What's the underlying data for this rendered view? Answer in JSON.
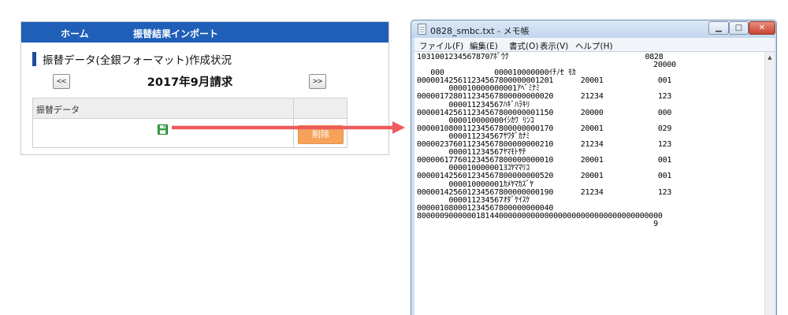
{
  "web": {
    "nav": {
      "home": "ホーム",
      "import": "振替結果インポート"
    },
    "section_title": "振替データ(全銀フォーマット)作成状況",
    "month": {
      "prev": "<<",
      "label": "2017年9月請求",
      "next": ">>"
    },
    "table": {
      "header": "振替データ"
    },
    "delete_label": "削除",
    "colors": {
      "navbar": "#1f5fb8",
      "delete": "#f6a25b",
      "arrow": "#ef5b5b"
    }
  },
  "notepad": {
    "title": "0828_smbc.txt - メモ帳",
    "window_controls": {
      "minimize": "▁",
      "maximize": "□",
      "close": "✕"
    },
    "menu": {
      "file": "ファイル(F)",
      "edit": "編集(E)",
      "format": "書式(O)",
      "view": "表示(V)",
      "help": "ヘルプ(H)"
    },
    "content": "1031001234567870ｱﾎﾟｳｸ                              0828\n                                                    20000\n   000           000010000000ｲﾁﾉｾ ﾓｶ\n000001425611234567800000001201      20001            001\n       000010000000001ｱﾍﾞﾐﾅﾐ\n000001728011234567800000000020      21234            123\n       000011234567ﾊｷﾞﾊﾗｷﾘ\n000001425611234567800000001150      20000            000\n       000010000000ｲｼｶﾜ ﾘﾝｺ\n000001080011234567800000000170      20001            029\n       000011234567ｻﾜﾀﾞｶﾅﾐ\n000002376011234567800000000210      21234            123\n       000011234567ﾔﾏﾓﾄｻﾁ\n000006177601234567800000000010      20001            001\n       000010000001ﾖｺﾔﾏﾏﾘｺ\n000001425601234567800000000520      20001            001\n       000010000001ｶﾒﾔﾏｶｽﾞﾔ\n000001425601234567800000000190      21234            123\n       000011234567ｵﾀﾞｹｲｽｹ\n000001080001234567800000000040\n800000900000018144000000000000000000000000000000000000\n                                                    9",
    "scroll_up": "▲"
  },
  "icons": {
    "save": "save-icon",
    "notepad_file": "notepad-file-icon",
    "arrow": "arrow-icon"
  }
}
